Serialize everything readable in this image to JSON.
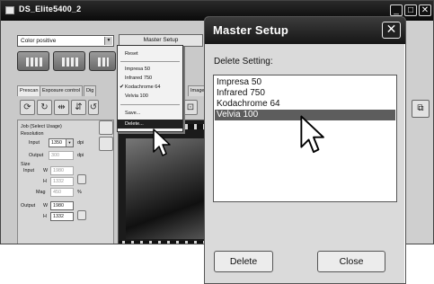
{
  "main_window": {
    "title": "DS_Elite5400_2",
    "profile_select_value": "Color positive",
    "master_setup_button": "Master Setup",
    "tabs": [
      "Prescan",
      "Exposure control",
      "Dig",
      "Image corr"
    ],
    "job_label": "Job (Select Usage)",
    "resolution_label": "Resolution",
    "input_label": "Input",
    "input_value": "1350",
    "dpi_unit": "dpi",
    "output_label": "Output",
    "output_value": "300",
    "size_label": "Size",
    "size_input_label": "Input",
    "w_label": "W",
    "h_label": "H",
    "mag_label": "Mag",
    "percent_unit": "%",
    "size_input_w": "1980",
    "size_input_h": "1332",
    "mag_value": "450",
    "output_w_label": "Output",
    "output_w_value": "1980",
    "output_h_value": "1332"
  },
  "popup_menu": {
    "reset": "Reset",
    "items": [
      {
        "label": "Impresa 50",
        "checked": false
      },
      {
        "label": "Infrared 750",
        "checked": false
      },
      {
        "label": "Kodachrome 64",
        "checked": true
      },
      {
        "label": "Velvia 100",
        "checked": false
      }
    ],
    "check_glyph": "✔",
    "save": "Save...",
    "delete": "Delete...",
    "highlighted": "Delete..."
  },
  "dialog": {
    "title": "Master Setup",
    "close_glyph": "✕",
    "delete_setting_label": "Delete Setting:",
    "settings": [
      "Impresa 50",
      "Infrared 750",
      "Kodachrome 64",
      "Velvia 100"
    ],
    "selected": "Velvia 100",
    "delete_button": "Delete",
    "close_button": "Close"
  },
  "icons": {
    "minimize": "_",
    "maximize": "□",
    "close": "✕"
  },
  "colors": {
    "titlebar": "#161616",
    "selection": "#5d5d5d",
    "menu_highlight": "#1f1f1f"
  }
}
